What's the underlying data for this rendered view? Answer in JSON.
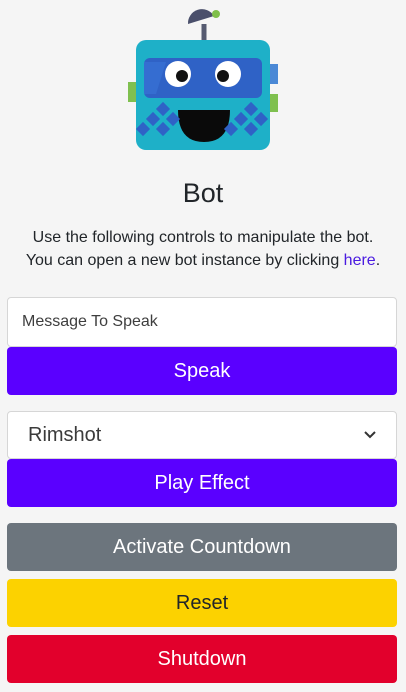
{
  "header": {
    "title": "Bot",
    "description_line1": "Use the following controls to manipulate the bot.",
    "description_line2_prefix": "You can open a new bot instance by clicking ",
    "description_link": "here",
    "description_line2_suffix": "."
  },
  "speak": {
    "placeholder": "Message To Speak",
    "button_label": "Speak"
  },
  "effect": {
    "selected": "Rimshot",
    "button_label": "Play Effect"
  },
  "actions": {
    "countdown_label": "Activate Countdown",
    "reset_label": "Reset",
    "shutdown_label": "Shutdown"
  },
  "colors": {
    "primary": "#5a00ff",
    "secondary": "#6c757d",
    "warning": "#fcd200",
    "danger": "#e2002c",
    "bot_body": "#1eb0c8",
    "bot_visor": "#2f62c6"
  }
}
